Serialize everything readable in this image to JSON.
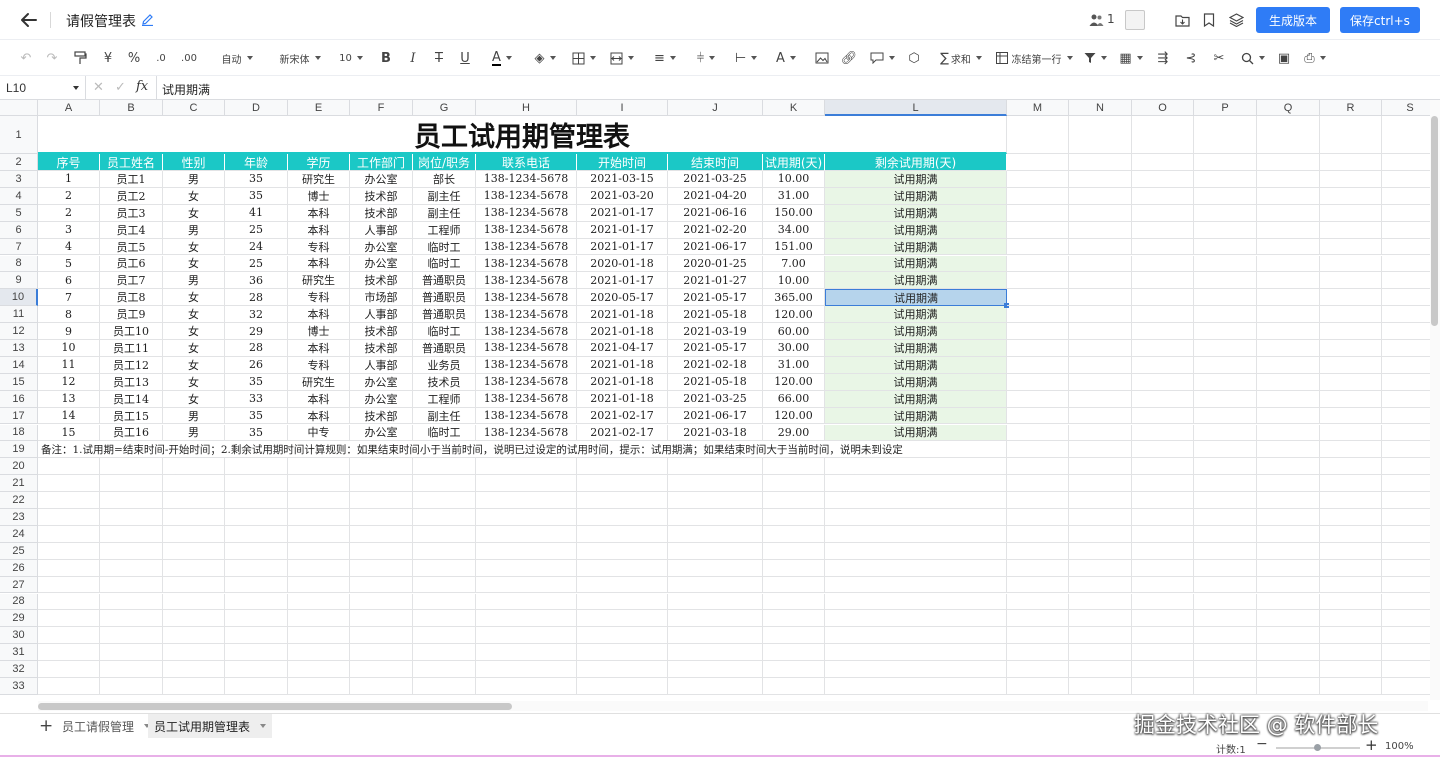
{
  "topbar": {
    "title": "请假管理表",
    "collab_count": "1",
    "generate_btn": "生成版本",
    "save_btn": "保存ctrl+s"
  },
  "toolbar": {
    "format_auto": "自动",
    "font_family": "新宋体",
    "font_size": "10",
    "sum_label": "求和",
    "freeze_label": "冻结第一行"
  },
  "formula": {
    "cell_ref": "L10",
    "fx": "fx",
    "value": "试用期满"
  },
  "sheet": {
    "columns": [
      "A",
      "B",
      "C",
      "D",
      "E",
      "F",
      "G",
      "H",
      "I",
      "J",
      "K",
      "L",
      "M",
      "N",
      "O",
      "P",
      "Q",
      "R",
      "S"
    ],
    "row_numbers": [
      "1",
      "2",
      "3",
      "4",
      "5",
      "6",
      "7",
      "8",
      "9",
      "10",
      "11",
      "12",
      "13",
      "14",
      "15",
      "16",
      "17",
      "18",
      "19",
      "20",
      "21",
      "22",
      "23",
      "24",
      "25",
      "26",
      "27",
      "28",
      "29",
      "30",
      "31",
      "32",
      "33"
    ],
    "title": "员工试用期管理表",
    "headers": [
      "序号",
      "员工姓名",
      "性别",
      "年龄",
      "学历",
      "工作部门",
      "岗位/职务",
      "联系电话",
      "开始时间",
      "结束时间",
      "试用期(天)",
      "剩余试用期(天)"
    ],
    "rows": [
      [
        "1",
        "员工1",
        "男",
        "35",
        "研究生",
        "办公室",
        "部长",
        "138-1234-5678",
        "2021-03-15",
        "2021-03-25",
        "10.00",
        "试用期满"
      ],
      [
        "2",
        "员工2",
        "女",
        "35",
        "博士",
        "技术部",
        "副主任",
        "138-1234-5678",
        "2021-03-20",
        "2021-04-20",
        "31.00",
        "试用期满"
      ],
      [
        "2",
        "员工3",
        "女",
        "41",
        "本科",
        "技术部",
        "副主任",
        "138-1234-5678",
        "2021-01-17",
        "2021-06-16",
        "150.00",
        "试用期满"
      ],
      [
        "3",
        "员工4",
        "男",
        "25",
        "本科",
        "人事部",
        "工程师",
        "138-1234-5678",
        "2021-01-17",
        "2021-02-20",
        "34.00",
        "试用期满"
      ],
      [
        "4",
        "员工5",
        "女",
        "24",
        "专科",
        "办公室",
        "临时工",
        "138-1234-5678",
        "2021-01-17",
        "2021-06-17",
        "151.00",
        "试用期满"
      ],
      [
        "5",
        "员工6",
        "女",
        "25",
        "本科",
        "办公室",
        "临时工",
        "138-1234-5678",
        "2020-01-18",
        "2020-01-25",
        "7.00",
        "试用期满"
      ],
      [
        "6",
        "员工7",
        "男",
        "36",
        "研究生",
        "技术部",
        "普通职员",
        "138-1234-5678",
        "2021-01-17",
        "2021-01-27",
        "10.00",
        "试用期满"
      ],
      [
        "7",
        "员工8",
        "女",
        "28",
        "专科",
        "市场部",
        "普通职员",
        "138-1234-5678",
        "2020-05-17",
        "2021-05-17",
        "365.00",
        "试用期满"
      ],
      [
        "8",
        "员工9",
        "女",
        "32",
        "本科",
        "人事部",
        "普通职员",
        "138-1234-5678",
        "2021-01-18",
        "2021-05-18",
        "120.00",
        "试用期满"
      ],
      [
        "9",
        "员工10",
        "女",
        "29",
        "博士",
        "技术部",
        "临时工",
        "138-1234-5678",
        "2021-01-18",
        "2021-03-19",
        "60.00",
        "试用期满"
      ],
      [
        "10",
        "员工11",
        "女",
        "28",
        "本科",
        "技术部",
        "普通职员",
        "138-1234-5678",
        "2021-04-17",
        "2021-05-17",
        "30.00",
        "试用期满"
      ],
      [
        "11",
        "员工12",
        "女",
        "26",
        "专科",
        "人事部",
        "业务员",
        "138-1234-5678",
        "2021-01-18",
        "2021-02-18",
        "31.00",
        "试用期满"
      ],
      [
        "12",
        "员工13",
        "女",
        "35",
        "研究生",
        "办公室",
        "技术员",
        "138-1234-5678",
        "2021-01-18",
        "2021-05-18",
        "120.00",
        "试用期满"
      ],
      [
        "13",
        "员工14",
        "女",
        "33",
        "本科",
        "办公室",
        "工程师",
        "138-1234-5678",
        "2021-01-18",
        "2021-03-25",
        "66.00",
        "试用期满"
      ],
      [
        "14",
        "员工15",
        "男",
        "35",
        "本科",
        "技术部",
        "副主任",
        "138-1234-5678",
        "2021-02-17",
        "2021-06-17",
        "120.00",
        "试用期满"
      ],
      [
        "15",
        "员工16",
        "男",
        "35",
        "中专",
        "办公室",
        "临时工",
        "138-1234-5678",
        "2021-02-17",
        "2021-03-18",
        "29.00",
        "试用期满"
      ]
    ],
    "note": "备注：1.试用期=结束时间-开始时间；2.剩余试用期时间计算规则：如果结束时间小于当前时间，说明已过设定的试用时间，提示：试用期满；如果结束时间大于当前时间，说明未到设定"
  },
  "tabs": [
    "员工请假管理",
    "员工试用期管理表"
  ],
  "status": {
    "count": "计数:1",
    "zoom": "100%",
    "watermark": "掘金技术社区 @ 软件部长"
  },
  "colors": {
    "header_bg": "#1bc8c6",
    "l_col_bg": "#e9f6e6",
    "selection": "#b6d4ec",
    "primary": "#2f7cf6"
  }
}
